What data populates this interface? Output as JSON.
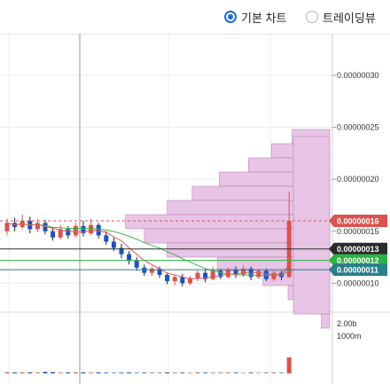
{
  "toolbar": {
    "basic_chart_label": "기본 차트",
    "tradingview_label": "트레이딩뷰",
    "selected": "basic"
  },
  "chart_data": {
    "type": "candlestick",
    "price_axis_ticks": [
      "0.00000030",
      "0.00000025",
      "0.00000020",
      "0.00000015",
      "0.00000010"
    ],
    "price_ticks_values": [
      3e-07,
      2.5e-07,
      2e-07,
      1.5e-07,
      1e-07
    ],
    "price_range": [
      5e-08,
      3.4e-07
    ],
    "volume_axis_ticks": [
      "2.00b",
      "1000m"
    ],
    "price_tags": [
      {
        "label": "0.00000016",
        "value": 1.6e-07,
        "color": "#d9534f"
      },
      {
        "label": "0.00000013",
        "value": 1.33e-07,
        "color": "#2b2b2b"
      },
      {
        "label": "0.00000012",
        "value": 1.22e-07,
        "color": "#2fb344"
      },
      {
        "label": "0.00000011",
        "value": 1.13e-07,
        "color": "#2a7f8c"
      }
    ],
    "colors": {
      "up": "#d9534f",
      "down": "#1f4fbf",
      "ma_short": "#e05a5a",
      "ma_long": "#3ab54a",
      "volume_profile": "#e8c4e6",
      "profile_border": "#b07aa8"
    }
  }
}
